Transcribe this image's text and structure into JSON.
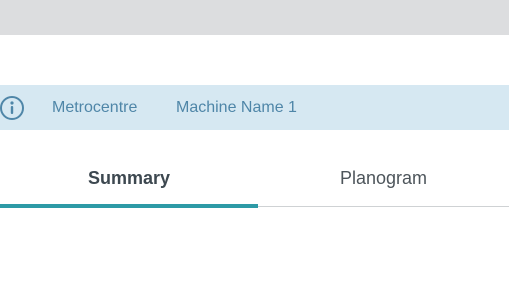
{
  "banner": {
    "location": "Metrocentre",
    "machine_name": "Machine Name 1",
    "icon": "info-icon"
  },
  "tabs": [
    {
      "label": "Summary",
      "active": true
    },
    {
      "label": "Planogram",
      "active": false
    }
  ],
  "colors": {
    "top_bar": "#dcdddf",
    "banner_bg": "#d6e8f2",
    "banner_text": "#4f86a8",
    "active_tab_underline": "#2d9aa6"
  }
}
